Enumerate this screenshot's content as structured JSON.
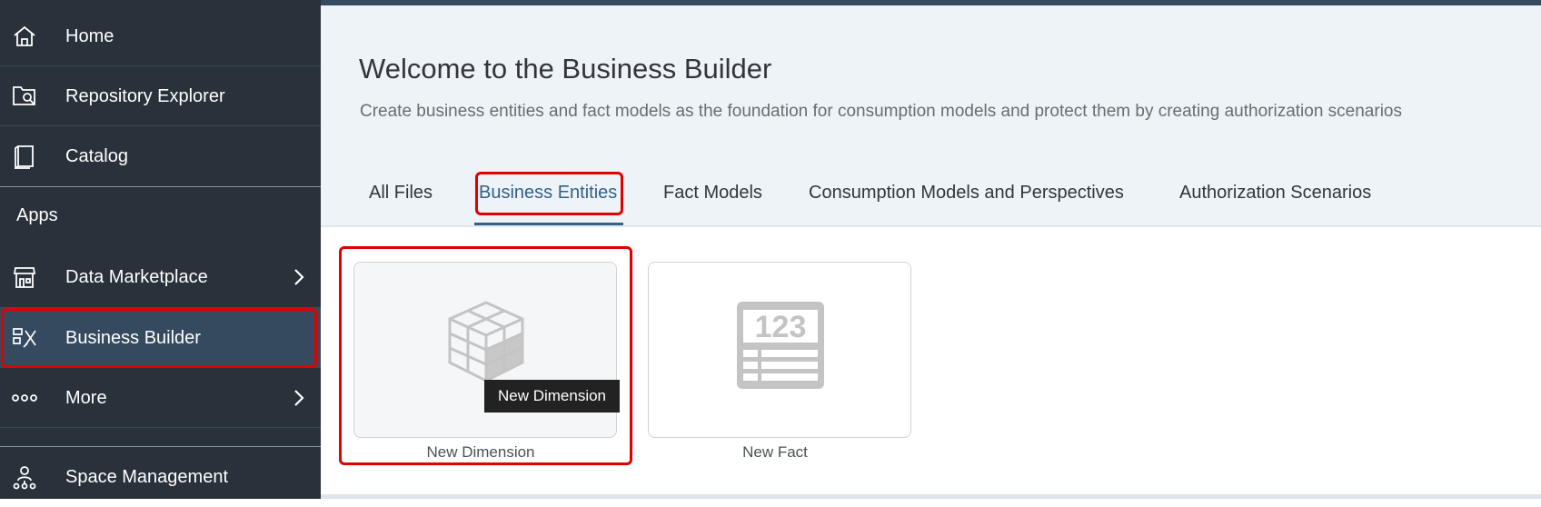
{
  "sidebar": {
    "items": [
      {
        "label": "Home"
      },
      {
        "label": "Repository Explorer"
      },
      {
        "label": "Catalog"
      },
      {
        "label": "Data Marketplace"
      },
      {
        "label": "Business Builder"
      },
      {
        "label": "More"
      },
      {
        "label": "Space Management"
      }
    ],
    "section_apps": "Apps"
  },
  "main": {
    "title": "Welcome to the Business Builder",
    "subtitle": "Create business entities and fact models as the foundation for consumption models and protect them by creating authorization scenarios",
    "tabs": [
      {
        "label": "All Files"
      },
      {
        "label": "Business Entities"
      },
      {
        "label": "Fact Models"
      },
      {
        "label": "Consumption Models and Perspectives"
      },
      {
        "label": "Authorization Scenarios"
      }
    ],
    "active_tab": "Business Entities",
    "tiles": [
      {
        "caption": "New Dimension"
      },
      {
        "caption": "New Fact",
        "icon_text": "123"
      }
    ],
    "tooltip": "New Dimension"
  },
  "colors": {
    "sidebar_bg": "#29313a",
    "selected_bg": "#354a5f",
    "accent": "#346187",
    "highlight": "#e00000",
    "header_bg": "#eef3f8"
  },
  "icons": [
    "home-icon",
    "repository-explorer-icon",
    "catalog-icon",
    "data-marketplace-icon",
    "business-builder-icon",
    "more-icon",
    "space-management-icon",
    "chevron-right-icon",
    "cube-icon",
    "fact-table-icon"
  ]
}
